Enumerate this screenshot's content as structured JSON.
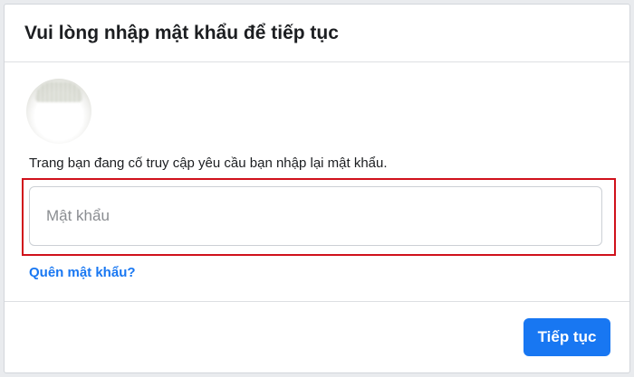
{
  "dialog": {
    "title": "Vui lòng nhập mật khẩu để tiếp tục",
    "description": "Trang bạn đang cố truy cập yêu cầu bạn nhập lại mật khẩu.",
    "password_field": {
      "placeholder": "Mật khẩu",
      "value": ""
    },
    "forgot_password_label": "Quên mật khẩu?",
    "continue_label": "Tiếp tục"
  },
  "colors": {
    "accent": "#1877f2",
    "highlight_border": "#d0111b",
    "text": "#1c1e21",
    "placeholder": "#8a8d91"
  },
  "icons": {
    "avatar": "profile-avatar"
  }
}
